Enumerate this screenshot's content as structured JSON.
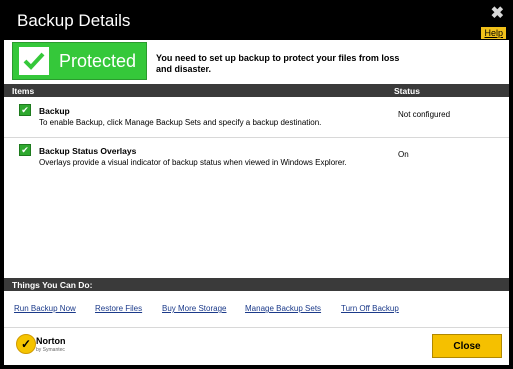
{
  "window": {
    "title": "Backup Details",
    "close_glyph": "✖",
    "help_label": "Help"
  },
  "status": {
    "badge_label": "Protected",
    "message": "You need to set up backup to protect your files from loss and disaster.",
    "accent_color": "#35c83a"
  },
  "table": {
    "columns": [
      "Items",
      "Status"
    ],
    "rows": [
      {
        "name": "Backup",
        "description": "To enable Backup, click Manage Backup Sets and specify a backup destination.",
        "status": "Not configured",
        "checked": true
      },
      {
        "name": "Backup Status Overlays",
        "description": "Overlays provide a visual indicator of backup status when viewed in Windows Explorer.",
        "status": "On",
        "checked": true
      }
    ]
  },
  "things": {
    "header": "Things You Can Do:",
    "links": [
      "Run Backup Now",
      "Restore Files",
      "Buy More Storage",
      "Manage Backup Sets",
      "Turn Off Backup"
    ]
  },
  "footer": {
    "brand": "Norton",
    "brand_sub": "by Symantec",
    "close_label": "Close"
  }
}
